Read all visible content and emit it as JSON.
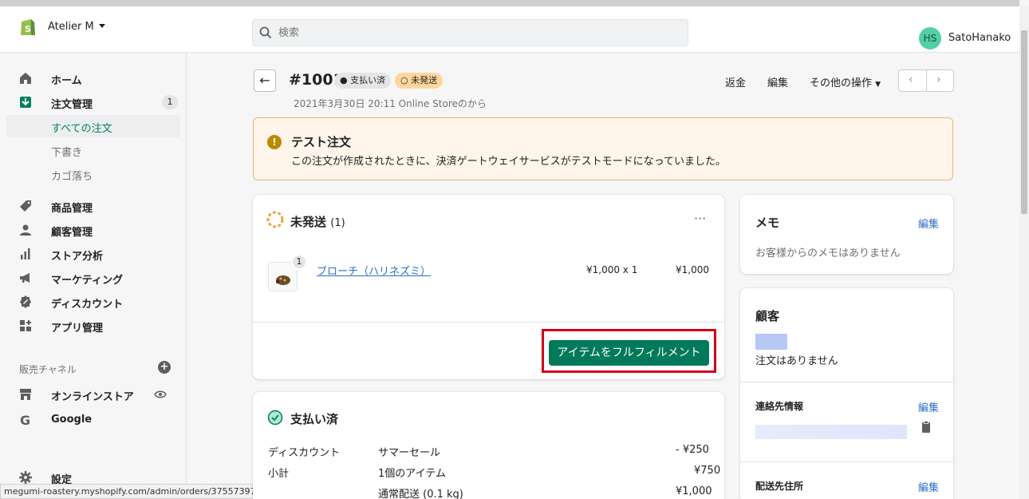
{
  "header": {
    "store_name": "Atelier M",
    "search_placeholder": "検索",
    "user_initials": "HS",
    "user_name": "SatoHanako"
  },
  "sidebar": {
    "items": [
      {
        "label": "ホーム",
        "icon": "home-icon"
      },
      {
        "label": "注文管理",
        "icon": "orders-icon",
        "badge": "1"
      },
      {
        "label": "すべての注文",
        "sub": true,
        "active": true
      },
      {
        "label": "下書き",
        "sub": true
      },
      {
        "label": "カゴ落ち",
        "sub": true
      },
      {
        "label": "商品管理",
        "icon": "tag-icon"
      },
      {
        "label": "顧客管理",
        "icon": "person-icon"
      },
      {
        "label": "ストア分析",
        "icon": "bar-chart-icon"
      },
      {
        "label": "マーケティング",
        "icon": "megaphone-icon"
      },
      {
        "label": "ディスカウント",
        "icon": "discount-icon"
      },
      {
        "label": "アプリ管理",
        "icon": "apps-icon"
      }
    ],
    "channels_label": "販売チャネル",
    "channels": [
      {
        "label": "オンラインストア",
        "icon": "store-icon"
      },
      {
        "label": "Google",
        "icon": "google-icon"
      }
    ],
    "settings_label": "設定"
  },
  "status_url": "megumi-roastery.myshopify.com/admin/orders/3755739774998/.../fulfill?locationI...",
  "order": {
    "id": "#1001",
    "paid_badge": "支払い済",
    "unfulfilled_badge": "未発送",
    "date": "2021年3月30日 20:11 Online Storeのから",
    "actions": {
      "refund": "返金",
      "edit": "編集",
      "more": "その他の操作"
    }
  },
  "banner": {
    "title": "テスト注文",
    "text": "この注文が作成されたときに、決済ゲートウェイサービスがテストモードになっていました。"
  },
  "unfulfilled_card": {
    "title": "未発送",
    "count": "(1)",
    "more": "···",
    "item": {
      "qty_badge": "1",
      "name": "ブローチ（ハリネズミ）",
      "price_qty": "¥1,000 x 1",
      "total": "¥1,000"
    },
    "fulfill_button": "アイテムをフルフィルメント"
  },
  "paid_card": {
    "title": "支払い済",
    "rows": [
      {
        "label": "ディスカウント",
        "desc": "サマーセール",
        "value": "- ¥250"
      },
      {
        "label": "小計",
        "desc": "1個のアイテム",
        "value": "¥750"
      },
      {
        "label": "",
        "desc": "通常配送 (0.1 kg)",
        "value": "¥1,000"
      }
    ]
  },
  "memo_card": {
    "title": "メモ",
    "edit": "編集",
    "text": "お客様からのメモはありません"
  },
  "customer_card": {
    "title": "顧客",
    "orders_text": "注文はありません",
    "contact_title": "連絡先情報",
    "contact_edit": "編集",
    "shipping_title": "配送先住所",
    "shipping_edit": "編集"
  },
  "colors": {
    "accent": "#007a5a",
    "highlight": "#d0021b",
    "banner_bg": "#fff5ea",
    "link": "#2c6ecb"
  }
}
